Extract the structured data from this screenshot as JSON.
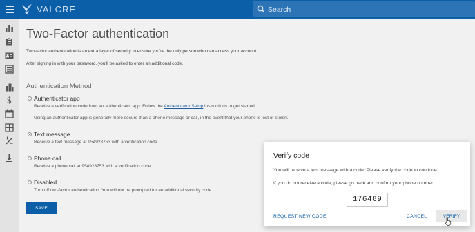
{
  "app": {
    "brand": "VALCRE",
    "colors": {
      "primary": "#0b5ea8",
      "search_bg": "#2c74b6",
      "page_bg": "#f1f1f1",
      "sidebar_bg": "#e3e3e3"
    }
  },
  "header": {
    "menu_icon": "hamburger-menu-icon",
    "logo_icon": "valcre-bird-logo",
    "search": {
      "placeholder": "Search",
      "value": "",
      "icon": "search-icon"
    }
  },
  "sidebar": {
    "items": [
      {
        "icon": "bar-chart-icon"
      },
      {
        "icon": "clipboard-icon"
      },
      {
        "icon": "contact-card-icon"
      },
      {
        "icon": "list-icon"
      },
      {
        "icon": "buildings-icon"
      },
      {
        "icon": "dollar-icon"
      },
      {
        "icon": "calendar-icon"
      },
      {
        "icon": "map-grid-icon"
      },
      {
        "icon": "percent-icon"
      },
      {
        "icon": "download-icon"
      }
    ]
  },
  "main": {
    "title": "Two-Factor authentication",
    "intro_1": "Two-factor authentication is an extra layer of security to ensure you're the only person who can access your account.",
    "intro_2": "After signing in with your password, you'll be asked to enter an additional code.",
    "section_title": "Authentication Method",
    "options": {
      "authenticator": {
        "label": "Authenticator app",
        "desc_before": "Receive a verification code from an authenticator app. Follow the ",
        "link": "Authenticator Setup",
        "desc_after": " instructions to get started.",
        "note": "Using an authenticator app is generally more secure than a phone message or call, in the event that your phone is lost or stolen.",
        "selected": false
      },
      "text": {
        "label": "Text message",
        "desc": "Receive a text message at 954928753 with a verification code.",
        "selected": true
      },
      "call": {
        "label": "Phone call",
        "desc": "Receive a phone call at 954928753 with a verification code.",
        "selected": false
      },
      "disabled": {
        "label": "Disabled",
        "desc": "Turn off two-factor authentication. You will not be prompted for an additional security code.",
        "selected": false
      }
    },
    "save_label": "SAVE"
  },
  "dialog": {
    "title": "Verify code",
    "text_1": "You will receive a text message with a code. Please verify the code to continue.",
    "text_2": "If you do not receive a code, please go back and confirm your phone number.",
    "code": "176489",
    "request_label": "REQUEST NEW CODE",
    "cancel_label": "CANCEL",
    "verify_label": "VERIFY"
  }
}
